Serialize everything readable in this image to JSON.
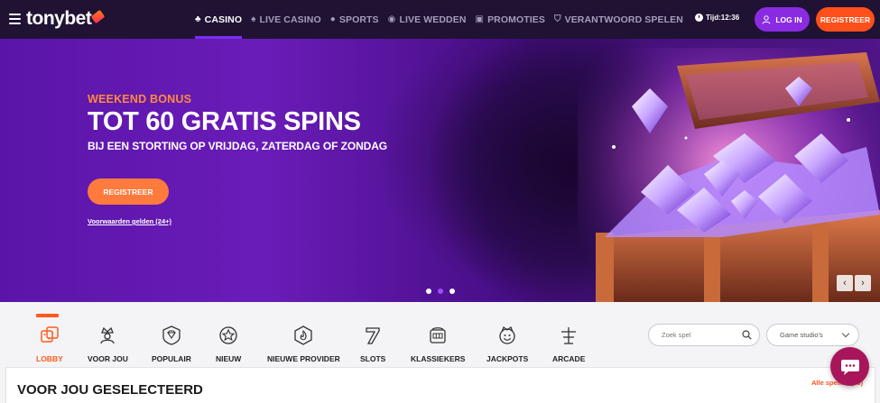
{
  "header": {
    "logo_text": "tonybet",
    "nav": [
      {
        "label": "CASINO",
        "icon": "casino-chip-icon",
        "active": true
      },
      {
        "label": "LIVE CASINO",
        "icon": "live-casino-icon",
        "active": false
      },
      {
        "label": "SPORTS",
        "icon": "sports-ball-icon",
        "active": false
      },
      {
        "label": "LIVE WEDDEN",
        "icon": "live-bet-icon",
        "active": false
      },
      {
        "label": "PROMOTIES",
        "icon": "gift-icon",
        "active": false
      },
      {
        "label": "VERANTWOORD SPELEN",
        "icon": "shield-icon",
        "active": false
      }
    ],
    "clock_label": "Tijd:12:36",
    "login_label": "LOG IN",
    "register_label": "REGISTREER"
  },
  "hero": {
    "kicker": "WEEKEND BONUS",
    "title": "TOT 60 GRATIS SPINS",
    "subtitle": "BIJ EEN STORTING OP VRIJDAG, ZATERDAG OF ZONDAG",
    "cta_label": "REGISTREER",
    "terms_label": "Voorwaarden gelden (24+)",
    "slides": 3,
    "active_slide": 2
  },
  "categories": [
    {
      "label": "LOBBY",
      "icon": "dice-icon",
      "active": true
    },
    {
      "label": "VOOR JOU",
      "icon": "crown-person-icon",
      "active": false
    },
    {
      "label": "POPULAIR",
      "icon": "diamond-badge-icon",
      "active": false
    },
    {
      "label": "NIEUW",
      "icon": "star-badge-icon",
      "active": false
    },
    {
      "label": "NIEUWE PROVIDER",
      "icon": "flame-badge-icon",
      "active": false
    },
    {
      "label": "SLOTS",
      "icon": "seven-icon",
      "active": false
    },
    {
      "label": "KLASSIEKERS",
      "icon": "slot-machine-icon",
      "active": false
    },
    {
      "label": "JACKPOTS",
      "icon": "jackpot-face-icon",
      "active": false
    },
    {
      "label": "ARCADE",
      "icon": "arcade-icon",
      "active": false
    }
  ],
  "search": {
    "placeholder": "Zoek spel"
  },
  "studios": {
    "label": "Game studio's"
  },
  "section": {
    "title": "VOOR JOU GESELECTEERD",
    "all_label": "Alle spellen (30)"
  },
  "colors": {
    "nav_bg": "#1f1233",
    "accent_purple": "#8a2be2",
    "accent_orange": "#ff4f1a",
    "hero_kicker": "#ff8a3d",
    "chat_bg": "#a8155a"
  }
}
